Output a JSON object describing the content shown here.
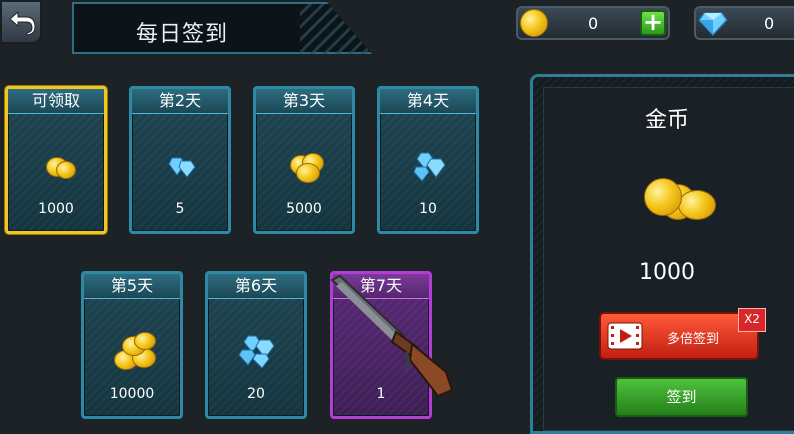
{
  "header": {
    "title": "每日签到",
    "back_icon": "back-arrow-icon"
  },
  "resources": {
    "coins": "0",
    "gems": "0",
    "add_icon": "plus-icon"
  },
  "days": [
    {
      "label": "可领取",
      "amount": "1000",
      "reward": "coin",
      "state": "claimable"
    },
    {
      "label": "第2天",
      "amount": "5",
      "reward": "diamond"
    },
    {
      "label": "第3天",
      "amount": "5000",
      "reward": "coin"
    },
    {
      "label": "第4天",
      "amount": "10",
      "reward": "diamond"
    },
    {
      "label": "第5天",
      "amount": "10000",
      "reward": "coin"
    },
    {
      "label": "第6天",
      "amount": "20",
      "reward": "diamond"
    },
    {
      "label": "第7天",
      "amount": "1",
      "reward": "shotgun"
    }
  ],
  "detail": {
    "title": "金币",
    "amount": "1000",
    "multi_button": "多倍签到",
    "multi_badge": "X2",
    "sign_button": "签到"
  },
  "colors": {
    "selected_border": "#f3c623",
    "card_border": "#2d8aa4",
    "special_border": "#b63cd6",
    "multi_button": "#e2362a",
    "sign_button": "#3aa82c"
  }
}
